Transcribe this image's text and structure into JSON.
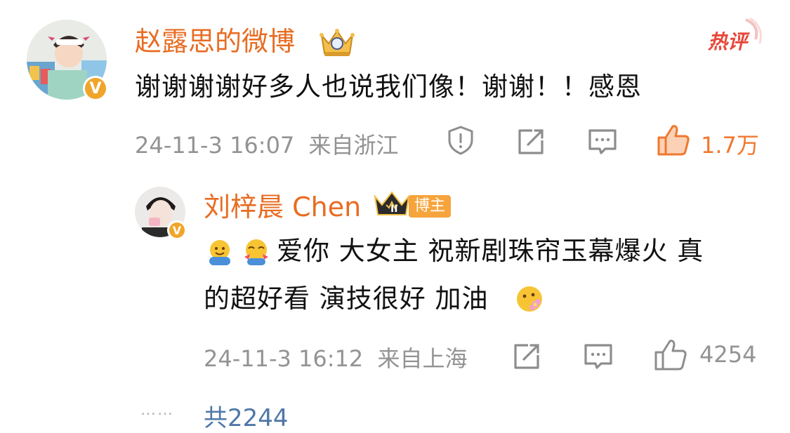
{
  "comment": {
    "username": "赵露思的微博",
    "hot_label": "热评",
    "text": "谢谢谢谢好多人也说我们像！谢谢！！感恩",
    "time": "24-11-3 16:07",
    "location": "来自浙江",
    "likes": "1.7万",
    "verified_badge": "V"
  },
  "reply": {
    "username": "刘梓晨 Chen",
    "role_tag": "博主",
    "crown_rank": "II",
    "text_line1": "爱你 大女主 祝新剧珠帘玉幕爆火 真",
    "text_line2": "的超好看 演技很好 加油",
    "time": "24-11-3 16:12",
    "location": "来自上海",
    "likes": "4254",
    "verified_badge": "V"
  },
  "footer": {
    "dots": "……",
    "expand_text": "共2244"
  },
  "icons": {
    "report": "report-icon",
    "repost": "repost-icon",
    "comment": "comment-icon",
    "like": "like-icon"
  },
  "colors": {
    "username": "#e86c22",
    "like_active": "#f07830",
    "meta": "#939393",
    "link": "#4f77a8"
  }
}
